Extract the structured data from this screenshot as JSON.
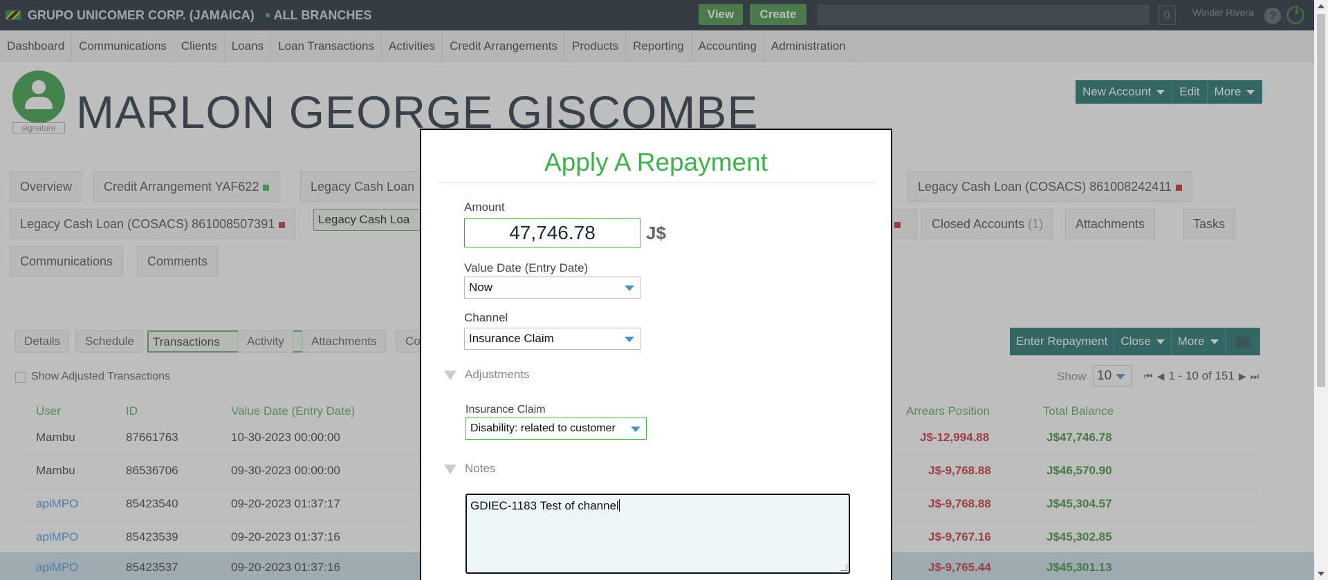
{
  "topbar": {
    "org": "GRUPO UNICOMER CORP. (JAMAICA)",
    "branch": "ALL BRANCHES",
    "view_label": "View",
    "create_label": "Create",
    "notifications": "0",
    "user": "Winder Rivera",
    "help": "?"
  },
  "nav": [
    "Dashboard",
    "Communications",
    "Clients",
    "Loans",
    "Loan Transactions",
    "Activities",
    "Credit Arrangements",
    "Products",
    "Reporting",
    "Accounting",
    "Administration"
  ],
  "client": {
    "signature_label": "signature",
    "name": "MARLON GEORGE GISCOMBE",
    "new_account": "New Account",
    "edit": "Edit",
    "more": "More"
  },
  "tabs": {
    "overview": "Overview",
    "credit_arr": "Credit Arrangement YAF622",
    "legacy1": "Legacy Cash Loan",
    "legacy_right": "Legacy Cash Loan (COSACS) 861008242411",
    "legacy_left": "Legacy Cash Loan (COSACS) 861008507391",
    "legacy_sel": "Legacy Cash Loa",
    "closed": "Closed Accounts",
    "closed_count": "(1)",
    "attachments": "Attachments",
    "tasks": "Tasks",
    "communications": "Communications",
    "comments": "Comments"
  },
  "subtabs": {
    "details": "Details",
    "schedule": "Schedule",
    "transactions": "Transactions",
    "activity": "Activity",
    "attachments": "Attachments",
    "co": "Co"
  },
  "txn_actions": {
    "enter_repayment": "Enter Repayment",
    "close": "Close",
    "more": "More"
  },
  "show_adjusted": "Show Adjusted Transactions",
  "pagination": {
    "show_label": "Show",
    "page_size": "10",
    "range": "1 - 10 of 151"
  },
  "table": {
    "headers": {
      "user": "User",
      "id": "ID",
      "value_date": "Value Date (Entry Date)",
      "arrears": "Arrears Position",
      "total_balance": "Total Balance"
    },
    "rows": [
      {
        "user": "Mambu",
        "id": "87661763",
        "date": "10-30-2023 00:00:00",
        "arrears": "J$-12,994.88",
        "balance": "J$47,746.78"
      },
      {
        "user": "Mambu",
        "id": "86536706",
        "date": "09-30-2023 00:00:00",
        "arrears": "J$-9,768.88",
        "balance": "J$46,570.90"
      },
      {
        "user": "apiMPO",
        "id": "85423540",
        "date": "09-20-2023 01:37:17",
        "arrears": "J$-9,768.88",
        "balance": "J$45,304.57"
      },
      {
        "user": "apiMPO",
        "id": "85423539",
        "date": "09-20-2023 01:37:16",
        "arrears": "J$-9,767.16",
        "balance": "J$45,302.85"
      },
      {
        "user": "apiMPO",
        "id": "85423537",
        "date": "09-20-2023 01:37:16",
        "arrears": "J$-9,765.44",
        "balance": "J$45,301.13"
      }
    ]
  },
  "modal": {
    "title": "Apply A Repayment",
    "amount_label": "Amount",
    "amount": "47,746.78",
    "currency": "J$",
    "value_date_label": "Value Date (Entry Date)",
    "value_date": "Now",
    "channel_label": "Channel",
    "channel": "Insurance Claim",
    "adjustments_label": "Adjustments",
    "insurance_claim_label": "Insurance Claim",
    "insurance_claim": "Disability: related to customer",
    "notes_label": "Notes",
    "notes": "GDIEC-1183 Test of channel"
  },
  "colors": {
    "accent_green": "#3fb14b",
    "teal": "#0f6a62",
    "negative": "#c0262b",
    "positive": "#2e8b2e"
  }
}
